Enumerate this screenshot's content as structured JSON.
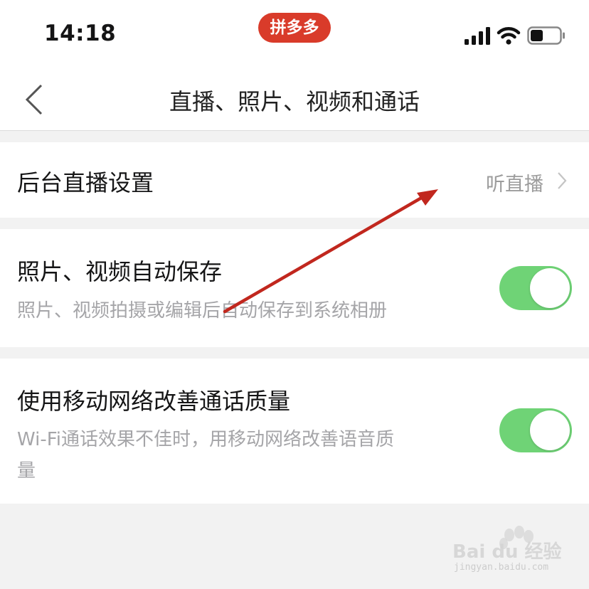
{
  "status_bar": {
    "time": "14:18",
    "app_label": "拼多多",
    "icons": [
      "cellular-signal-icon",
      "wifi-icon",
      "battery-icon"
    ]
  },
  "nav": {
    "title": "直播、照片、视频和通话",
    "back_icon": "chevron-left-icon"
  },
  "settings": {
    "live": {
      "title": "后台直播设置",
      "value": "听直播"
    },
    "autosave": {
      "title": "照片、视频自动保存",
      "desc": "照片、视频拍摄或编辑后自动保存到系统相册",
      "enabled": true
    },
    "mobile_call": {
      "title": "使用移动网络改善通话质量",
      "desc_line1": "Wi-Fi通话效果不佳时，用移动网络改善语音质",
      "desc_line2": "量",
      "enabled": true
    }
  },
  "watermark": {
    "text": "Bai du 经验",
    "url": "jingyan.baidu.com"
  },
  "colors": {
    "accent_red": "#d93b2a",
    "toggle_on": "#6fd376",
    "annotation_arrow": "#c1271e"
  }
}
